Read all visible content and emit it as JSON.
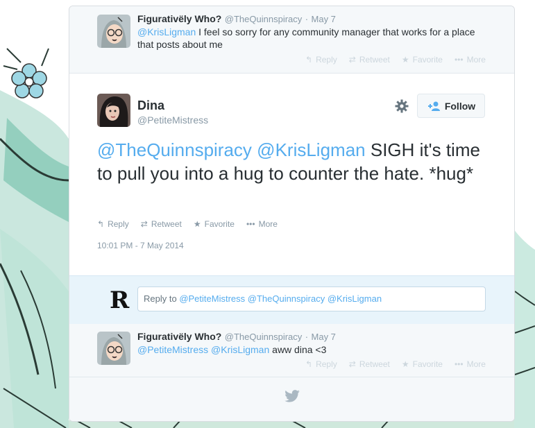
{
  "context_tweet_1": {
    "name": "Figurativëly Who?",
    "handle": "@TheQuinnspiracy",
    "separator": "·",
    "date": "May 7",
    "mention": "@KrisLigman",
    "text": " I feel so sorry for any community manager that works for a place that posts about me"
  },
  "main_tweet": {
    "name": "Dina",
    "handle": "@PetiteMistress",
    "follow_label": "Follow",
    "mention1": "@TheQuinnspiracy",
    "mention2": "@KrisLigman",
    "text": " SIGH it's time to pull you into a hug to counter the hate. *hug*",
    "timestamp": "10:01 PM - 7 May 2014"
  },
  "actions": {
    "reply": "Reply",
    "retweet": "Retweet",
    "favorite": "Favorite",
    "more": "More"
  },
  "reply_box": {
    "prefix": "Reply to ",
    "mentions": "@PetiteMistress @TheQuinnspiracy @KrisLigman"
  },
  "context_tweet_2": {
    "name": "Figurativëly Who?",
    "handle": "@TheQuinnspiracy",
    "separator": "·",
    "date": "May 7",
    "mention1": "@PetiteMistress",
    "mention2": "@KrisLigman",
    "text": " aww dina <3"
  },
  "colors": {
    "link": "#55acee",
    "text": "#292f33",
    "muted": "#8899a6",
    "reply_bar": "#e8f4fb"
  }
}
